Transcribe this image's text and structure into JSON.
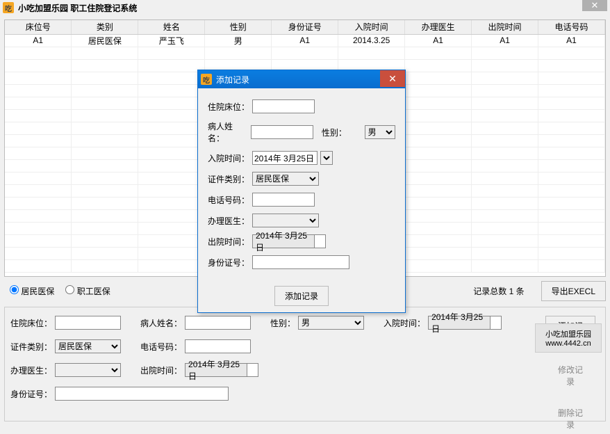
{
  "app": {
    "title": "小吃加盟乐园 职工住院登记系统",
    "icon_glyph": "吃",
    "close_glyph": "✕"
  },
  "table": {
    "headers": [
      "床位号",
      "类别",
      "姓名",
      "性别",
      "身份证号",
      "入院时间",
      "办理医生",
      "出院时间",
      "电话号码"
    ],
    "rows": [
      [
        "A1",
        "居民医保",
        "严玉飞",
        "男",
        "A1",
        "2014.3.25",
        "A1",
        "A1",
        "A1"
      ]
    ]
  },
  "filters": {
    "opt1": "居民医保",
    "opt2": "职工医保"
  },
  "count_label": "记录总数 1 条",
  "export_label": "导出EXECL",
  "form": {
    "bed_label": "住院床位：",
    "bed": "",
    "name_label": "病人姓名：",
    "name": "",
    "gender_label": "性别：",
    "gender": "男",
    "admit_label": "入院时间：",
    "admit": "2014年 3月25日",
    "cert_label": "证件类别：",
    "cert": "居民医保",
    "phone_label": "电话号码：",
    "phone": "",
    "doctor_label": "办理医生：",
    "doctor": "",
    "discharge_label": "出院时间：",
    "discharge": "2014年 3月25日",
    "idnum_label": "身份证号：",
    "idnum": ""
  },
  "side_buttons": {
    "add": "添加记录",
    "edit": "修改记录",
    "del": "删除记录"
  },
  "brand": {
    "line1": "小吃加盟乐园",
    "line2": "www.4442.cn"
  },
  "dialog": {
    "title": "添加记录",
    "bed_label": "住院床位：",
    "name_label": "病人姓名：",
    "gender_label": "性别：",
    "gender": "男",
    "admit_label": "入院时间：",
    "admit": "2014年 3月25日",
    "cert_label": "证件类别：",
    "cert": "居民医保",
    "phone_label": "电话号码：",
    "doctor_label": "办理医生：",
    "discharge_label": "出院时间：",
    "discharge": "2014年 3月25日",
    "idnum_label": "身份证号：",
    "add_btn": "添加记录"
  }
}
